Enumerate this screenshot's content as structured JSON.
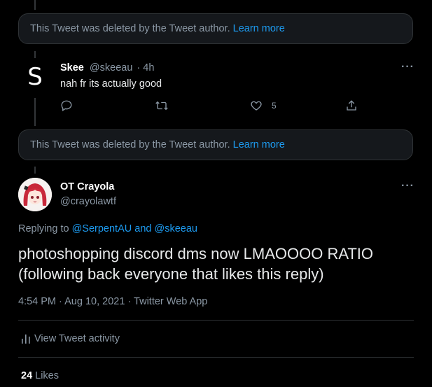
{
  "deleted_notice": {
    "text": "This Tweet was deleted by the Tweet author.",
    "link": "Learn more"
  },
  "reply_tweet": {
    "avatar_letter": "S",
    "name": "Skee",
    "handle": "@skeeau",
    "time": "· 4h",
    "text": "nah fr its actually good",
    "like_count": "5",
    "more": "···"
  },
  "main_tweet": {
    "name": "OT Crayola",
    "handle": "@crayolawtf",
    "more": "···",
    "replying_prefix": "Replying to",
    "mention_1": "@SerpentAU",
    "and_word": "and",
    "mention_2": "@skeeau",
    "text_line_1": "photoshopping discord dms now LMAOOOO RATIO",
    "text_line_2": "(following back everyone that likes this reply)",
    "time": "4:54 PM",
    "sep": "·",
    "date": "Aug 10, 2021",
    "client": "Twitter Web App",
    "activity_label": "View Tweet activity",
    "likes_count": "24",
    "likes_label": "Likes"
  },
  "colors": {
    "background": "#000000",
    "accent": "#1d9bf0",
    "muted": "#8b98a5",
    "divider": "#2f3336"
  }
}
